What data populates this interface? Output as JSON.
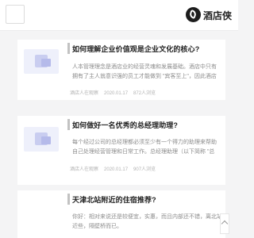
{
  "header": {
    "site_name": "酒店侠",
    "menu_icon": "menu-icon",
    "logo_icon": "logo-icon"
  },
  "articles": [
    {
      "title": "如何理解企业价值观是企业文化的核心?",
      "excerpt": "人本管理理念是酒店业的经营灵魂和发展基础。酒店中只有拥有了主人翁意识强的员工才能做到 \"宾客至上\"，因此酒店管理者要给予员工以家的、公民...",
      "author": "酒店人在观察",
      "date": "2020.01.17",
      "views": "872人浏览"
    },
    {
      "title": "如何做好一名优秀的总经理助理?",
      "excerpt": "每个经过公司的总经理都必须至少有一个得力的助理来帮助自己处理经营管理和日常工作。总经理助理（以下简称 \"总助\"）在企业发展中具有举足轻重的...",
      "author": "酒店人在观察",
      "date": "2020.01.17",
      "views": "907人浏览"
    },
    {
      "title": "天津北站附近的住宿推荐?",
      "excerpt": "你好：相对来说还是较便宜，实惠，而且内部还不错，离北站近些，隔壁桥而已。",
      "author": "",
      "date": "",
      "views": ""
    }
  ],
  "colors": {
    "background": "#f4f4f5",
    "card": "#ffffff",
    "title": "#1f1f1f",
    "excerpt": "#8c8c8c",
    "meta": "#b3b3b3"
  }
}
